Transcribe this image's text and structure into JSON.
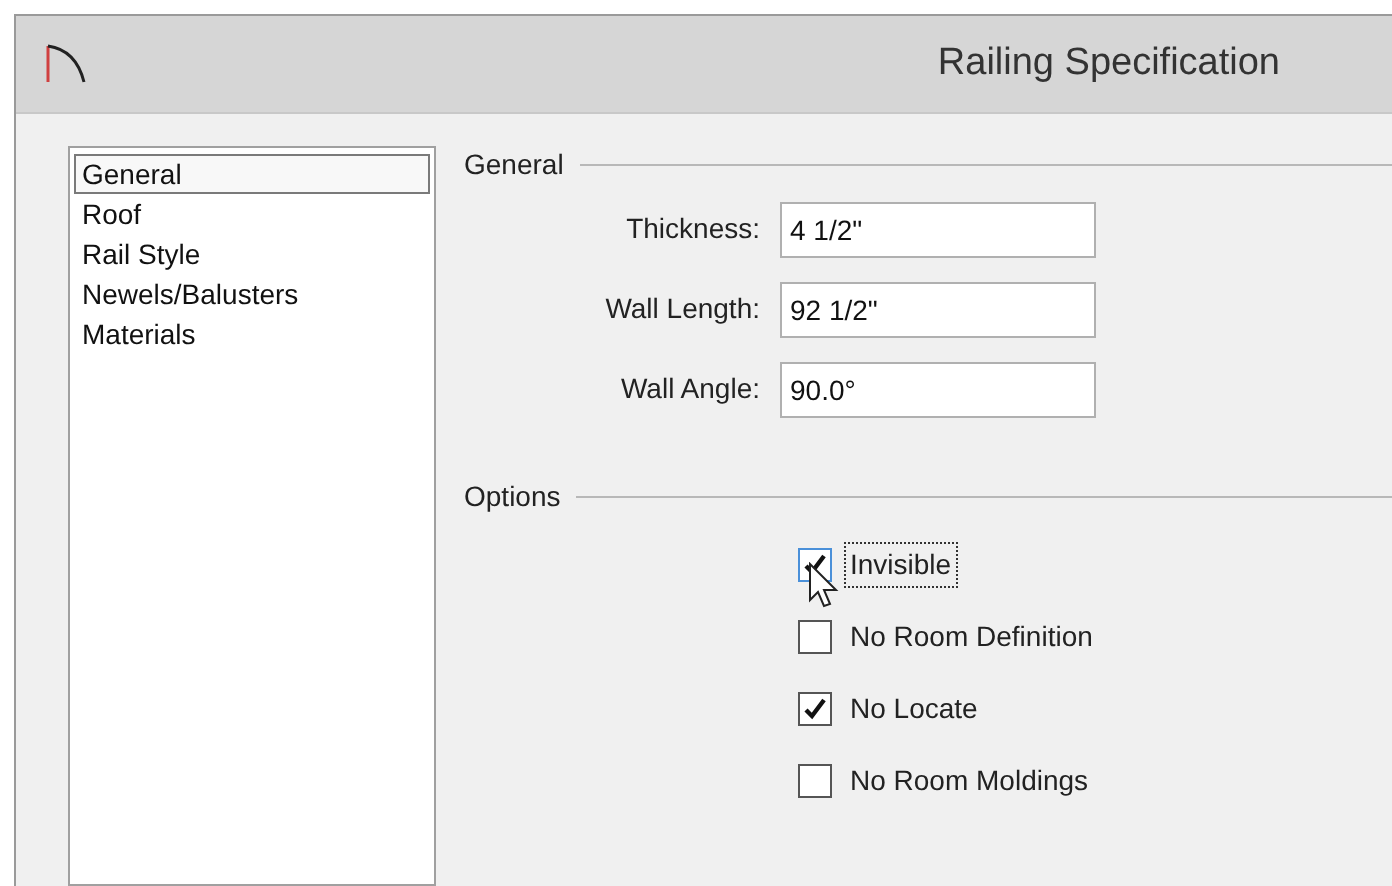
{
  "window": {
    "title": "Railing Specification"
  },
  "sidebar": {
    "items": [
      {
        "label": "General",
        "selected": true
      },
      {
        "label": "Roof",
        "selected": false
      },
      {
        "label": "Rail Style",
        "selected": false
      },
      {
        "label": "Newels/Balusters",
        "selected": false
      },
      {
        "label": "Materials",
        "selected": false
      }
    ]
  },
  "general": {
    "title": "General",
    "fields": [
      {
        "label": "Thickness:",
        "value": "4 1/2\""
      },
      {
        "label": "Wall Length:",
        "value": "92 1/2\""
      },
      {
        "label": "Wall Angle:",
        "value": "90.0°"
      }
    ]
  },
  "options": {
    "title": "Options",
    "items": [
      {
        "label": "Invisible",
        "checked": true,
        "focused": true
      },
      {
        "label": "No Room Definition",
        "checked": false,
        "focused": false
      },
      {
        "label": "No Locate",
        "checked": true,
        "focused": false
      },
      {
        "label": "No Room Moldings",
        "checked": false,
        "focused": false
      }
    ]
  }
}
